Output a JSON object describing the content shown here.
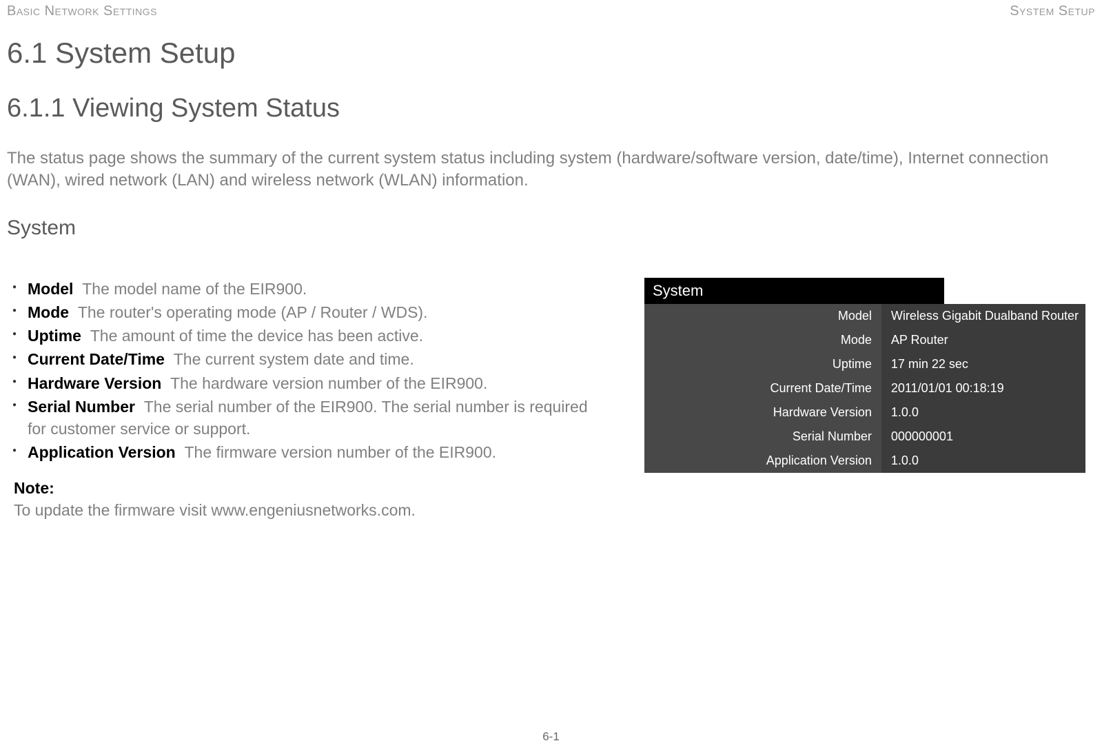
{
  "header": {
    "left": "Basic Network Settings",
    "right": "System Setup"
  },
  "headings": {
    "section": "6.1 System Setup",
    "subsection": "6.1.1 Viewing System Status",
    "system": "System"
  },
  "intro": "The status page shows the summary of the current system status including system (hardware/software version, date/time), Internet connection (WAN), wired network (LAN) and wireless network (WLAN) information.",
  "bullets": [
    {
      "term": "Model",
      "desc": "The model name of the EIR900."
    },
    {
      "term": "Mode",
      "desc": "The router's operating mode (AP / Router / WDS)."
    },
    {
      "term": "Uptime",
      "desc": "The amount of time the device has been active."
    },
    {
      "term": "Current Date/Time",
      "desc": "The current system date and time."
    },
    {
      "term": "Hardware Version",
      "desc": "The hardware version number of the EIR900."
    },
    {
      "term": "Serial Number",
      "desc": "The serial number of the EIR900. The serial number is required for customer service or support."
    },
    {
      "term": "Application Version",
      "desc": "The firmware version number of the EIR900."
    }
  ],
  "note": {
    "label": "Note:",
    "text": "To update the firmware visit www.engeniusnetworks.com."
  },
  "panel": {
    "title": "System",
    "rows": [
      {
        "label": "Model",
        "value": "Wireless Gigabit Dualband Router"
      },
      {
        "label": "Mode",
        "value": "AP Router"
      },
      {
        "label": "Uptime",
        "value": "17 min 22 sec"
      },
      {
        "label": "Current Date/Time",
        "value": "2011/01/01 00:18:19"
      },
      {
        "label": "Hardware Version",
        "value": "1.0.0"
      },
      {
        "label": "Serial Number",
        "value": "000000001"
      },
      {
        "label": "Application Version",
        "value": "1.0.0"
      }
    ]
  },
  "page_number": "6-1"
}
